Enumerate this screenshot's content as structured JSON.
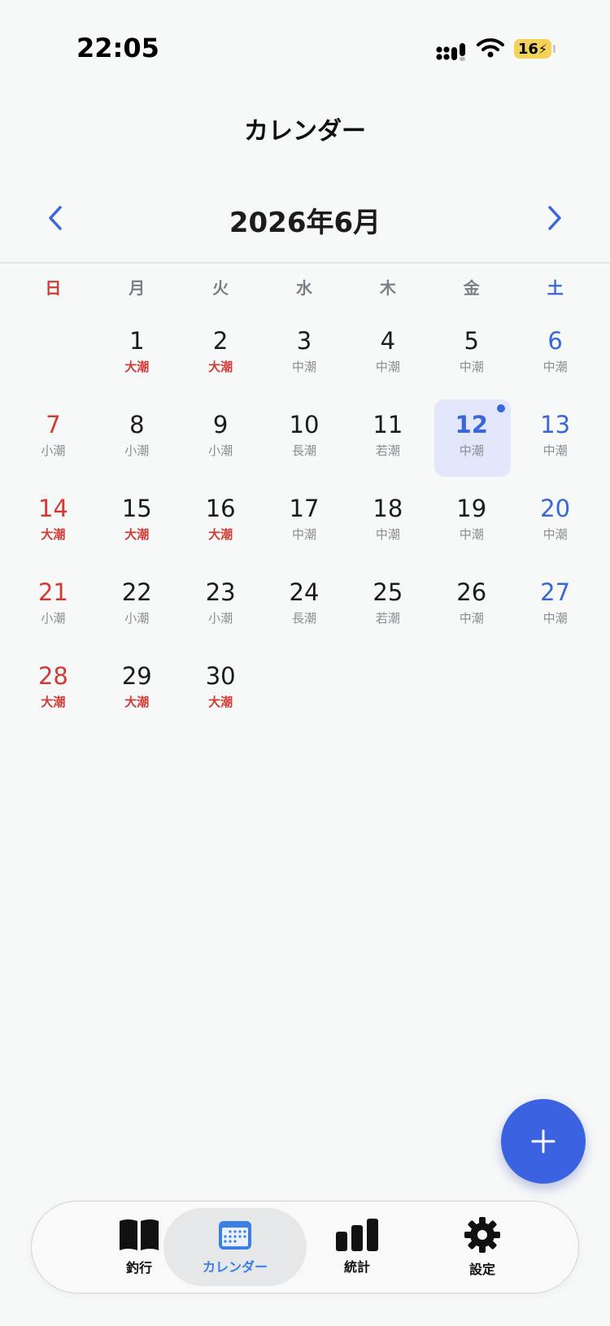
{
  "status_bar": {
    "time": "22:05",
    "battery": "16"
  },
  "header": {
    "title": "カレンダー",
    "month": "2026年6月"
  },
  "weekdays": [
    "日",
    "月",
    "火",
    "水",
    "木",
    "金",
    "土"
  ],
  "calendar": {
    "today": "12",
    "weeks": [
      [
        {
          "day": "",
          "tide": ""
        },
        {
          "day": "1",
          "tide": "大潮"
        },
        {
          "day": "2",
          "tide": "大潮"
        },
        {
          "day": "3",
          "tide": "中潮"
        },
        {
          "day": "4",
          "tide": "中潮"
        },
        {
          "day": "5",
          "tide": "中潮"
        },
        {
          "day": "6",
          "tide": "中潮"
        }
      ],
      [
        {
          "day": "7",
          "tide": "小潮"
        },
        {
          "day": "8",
          "tide": "小潮"
        },
        {
          "day": "9",
          "tide": "小潮"
        },
        {
          "day": "10",
          "tide": "長潮"
        },
        {
          "day": "11",
          "tide": "若潮"
        },
        {
          "day": "12",
          "tide": "中潮"
        },
        {
          "day": "13",
          "tide": "中潮"
        }
      ],
      [
        {
          "day": "14",
          "tide": "大潮"
        },
        {
          "day": "15",
          "tide": "大潮"
        },
        {
          "day": "16",
          "tide": "大潮"
        },
        {
          "day": "17",
          "tide": "中潮"
        },
        {
          "day": "18",
          "tide": "中潮"
        },
        {
          "day": "19",
          "tide": "中潮"
        },
        {
          "day": "20",
          "tide": "中潮"
        }
      ],
      [
        {
          "day": "21",
          "tide": "小潮"
        },
        {
          "day": "22",
          "tide": "小潮"
        },
        {
          "day": "23",
          "tide": "小潮"
        },
        {
          "day": "24",
          "tide": "長潮"
        },
        {
          "day": "25",
          "tide": "若潮"
        },
        {
          "day": "26",
          "tide": "中潮"
        },
        {
          "day": "27",
          "tide": "中潮"
        }
      ],
      [
        {
          "day": "28",
          "tide": "大潮"
        },
        {
          "day": "29",
          "tide": "大潮"
        },
        {
          "day": "30",
          "tide": "大潮"
        },
        {
          "day": "",
          "tide": ""
        },
        {
          "day": "",
          "tide": ""
        },
        {
          "day": "",
          "tide": ""
        },
        {
          "day": "",
          "tide": ""
        }
      ]
    ]
  },
  "fab": {
    "icon": "plus-icon"
  },
  "tabbar": {
    "tabs": [
      {
        "label": "釣行",
        "icon": "book-icon"
      },
      {
        "label": "カレンダー",
        "icon": "calendar-icon",
        "active": true
      },
      {
        "label": "統計",
        "icon": "bar-chart-icon"
      },
      {
        "label": "設定",
        "icon": "gear-icon"
      }
    ]
  },
  "colors": {
    "accent": "#3a62e1",
    "sunday": "#d23a35",
    "saturday": "#3a66d9",
    "today_bg": "#e2e7fb",
    "tab_active_label": "#3a7ee6"
  }
}
